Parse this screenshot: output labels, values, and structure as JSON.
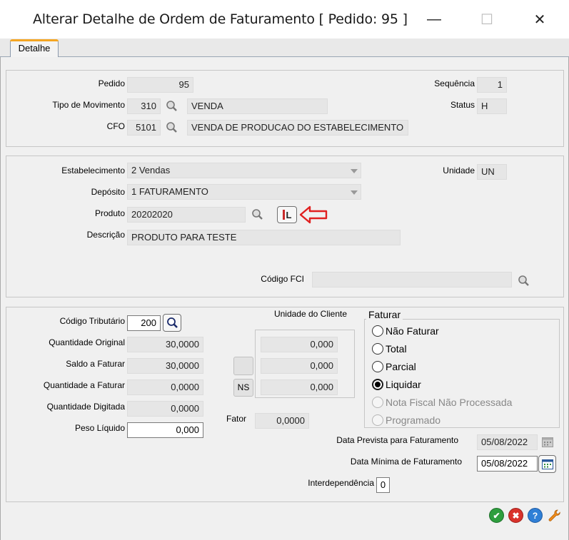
{
  "window": {
    "title": "Alterar Detalhe de Ordem de Faturamento [ Pedido: 95 ]",
    "minimize_glyph": "—",
    "maximize_glyph": "☐",
    "close_glyph": "✕"
  },
  "tabs": [
    {
      "label": "Detalhe",
      "active": true
    }
  ],
  "header": {
    "pedido_label": "Pedido",
    "pedido_value": "95",
    "tipo_label": "Tipo de Movimento",
    "tipo_code": "310",
    "tipo_desc": "VENDA",
    "cfo_label": "CFO",
    "cfo_code": "5101",
    "cfo_desc": "VENDA DE PRODUCAO DO ESTABELECIMENTO",
    "sequencia_label": "Sequência",
    "sequencia_value": "1",
    "status_label": "Status",
    "status_value": "H"
  },
  "produto_section": {
    "estabelecimento_label": "Estabelecimento",
    "estabelecimento_value": "2 Vendas",
    "deposito_label": "Depósito",
    "deposito_value": "1 FATURAMENTO",
    "produto_label": "Produto",
    "produto_value": "20202020",
    "lote_button_glyph": "L",
    "descricao_label": "Descrição",
    "descricao_value": "PRODUTO PARA TESTE",
    "unidade_label": "Unidade",
    "unidade_value": "UN",
    "codigo_fci_label": "Código FCI",
    "codigo_fci_value": ""
  },
  "quantidades": {
    "codigo_tributario_label": "Código Tributário",
    "codigo_tributario_value": "200",
    "qtd_original_label": "Quantidade Original",
    "qtd_original_value": "30,0000",
    "saldo_label": "Saldo a Faturar",
    "saldo_value": "30,0000",
    "qtd_faturar_label": "Quantidade a Faturar",
    "qtd_faturar_value": "0,0000",
    "qtd_digitada_label": "Quantidade Digitada",
    "qtd_digitada_value": "0,0000",
    "peso_label": "Peso Líquido",
    "peso_value": "0,000",
    "unidade_cliente_label": "Unidade do Cliente",
    "uc_values": [
      "0,000",
      "0,000",
      "0,000"
    ],
    "ns_button_label": "NS",
    "fator_label": "Fator",
    "fator_value": "0,0000"
  },
  "faturar": {
    "legend": "Faturar",
    "options": [
      {
        "label": "Não Faturar",
        "selected": false,
        "enabled": true
      },
      {
        "label": "Total",
        "selected": false,
        "enabled": true
      },
      {
        "label": "Parcial",
        "selected": false,
        "enabled": true
      },
      {
        "label": "Liquidar",
        "selected": true,
        "enabled": true
      },
      {
        "label": "Nota Fiscal Não Processada",
        "selected": false,
        "enabled": false
      },
      {
        "label": "Programado",
        "selected": false,
        "enabled": false
      }
    ]
  },
  "datas": {
    "prevista_label": "Data Prevista para Faturamento",
    "prevista_value": "05/08/2022",
    "minima_label": "Data Mínima de Faturamento",
    "minima_value": "05/08/2022",
    "interdependencia_label": "Interdependência",
    "interdependencia_value": "0"
  },
  "actions": {
    "ok_glyph": "✔",
    "cancel_glyph": "✖",
    "help_glyph": "?",
    "tools_glyph": "🔧"
  },
  "colors": {
    "ok": "#2e9e3e",
    "cancel": "#d9322b",
    "help": "#2f7fd6",
    "tools": "#f08c1a",
    "arrow": "#e02020"
  }
}
